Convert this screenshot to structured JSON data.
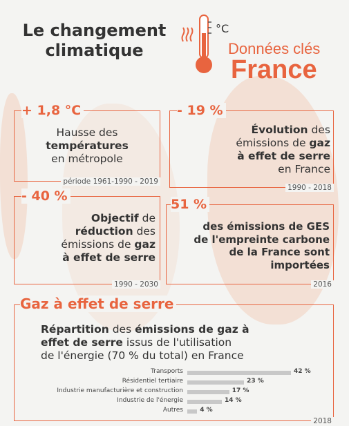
{
  "header": {
    "title_line1": "Le changement",
    "title_line2": "climatique",
    "degree_symbol": "°C",
    "key_label": "Données clés",
    "key_country": "France"
  },
  "cards": [
    {
      "value": "+ 1,8 °C",
      "text_lines": [
        [
          "",
          "Hausse des"
        ],
        [
          "températures",
          ""
        ],
        [
          "",
          "en métropole"
        ]
      ],
      "period": "période 1961-1990 - 2019"
    },
    {
      "value": "- 19 %",
      "text_lines": [
        [
          "Évolution",
          " des"
        ],
        [
          "",
          "émissions de "
        ],
        [
          "gaz",
          ""
        ],
        [
          "à effet de serre",
          ""
        ],
        [
          "",
          "en France"
        ]
      ],
      "period": "1990 - 2018"
    },
    {
      "value": "- 40 %",
      "text_lines": [
        [
          "Objectif",
          " de"
        ],
        [
          "réduction",
          " des"
        ],
        [
          "",
          "émissions de "
        ],
        [
          "gaz",
          ""
        ],
        [
          "à effet de serre",
          ""
        ]
      ],
      "period": "1990 - 2030"
    },
    {
      "value": "51 %",
      "text_lines": [
        "des émissions de GES",
        "de l'empreinte carbone",
        "de la France sont",
        "importées"
      ],
      "period": "2016"
    }
  ],
  "ghg": {
    "section_title": "Gaz à effet de serre",
    "subtitle_line1_bold1": "Répartition",
    "subtitle_line1_plain": " des ",
    "subtitle_line1_bold2": "émissions de gaz à",
    "subtitle_line2_bold": "effet de serre",
    "subtitle_line2_plain": " issus de l'utilisation",
    "subtitle_line3": "de l'énergie (70 % du total) en France",
    "year": "2018"
  },
  "chart_data": {
    "type": "bar",
    "orientation": "horizontal",
    "categories": [
      "Transports",
      "Résidentiel tertiaire",
      "Industrie manufacturière et construction",
      "Industrie de l'énergie",
      "Autres"
    ],
    "values": [
      42,
      23,
      17,
      14,
      4
    ],
    "value_labels": [
      "42 %",
      "23 %",
      "17 %",
      "14 %",
      "4 %"
    ],
    "unit": "%",
    "bar_color": "#c8c8c8"
  },
  "colors": {
    "accent": "#e8643f",
    "text": "#333333",
    "background": "#f4f4f2"
  }
}
